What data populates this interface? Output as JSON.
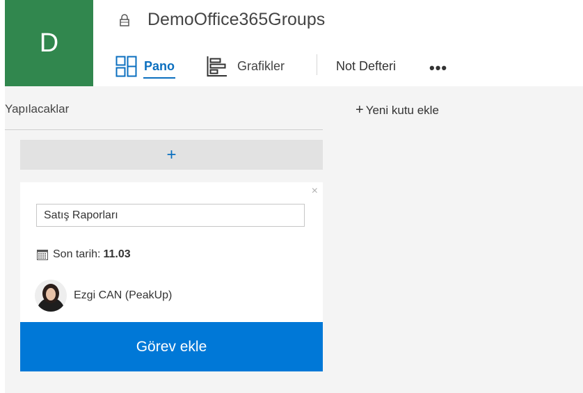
{
  "group": {
    "initial": "D",
    "name": "DemoOffice365Groups"
  },
  "nav": {
    "pano": "Pano",
    "grafikler": "Grafikler",
    "not_defteri": "Not Defteri",
    "more": "•••"
  },
  "bucket": {
    "title": "Yapılacaklar",
    "add_symbol": "+"
  },
  "new_bucket": {
    "plus": "+",
    "label": "Yeni kutu ekle"
  },
  "task_form": {
    "close": "×",
    "title_value": "Satış Raporları",
    "due_label": "Son tarih:",
    "due_value": "11.03",
    "assignee": "Ezgi CAN (PeakUp)",
    "submit_label": "Görev ekle"
  },
  "colors": {
    "tile": "#31874e",
    "accent": "#0b6fbf",
    "button": "#0078d7"
  }
}
